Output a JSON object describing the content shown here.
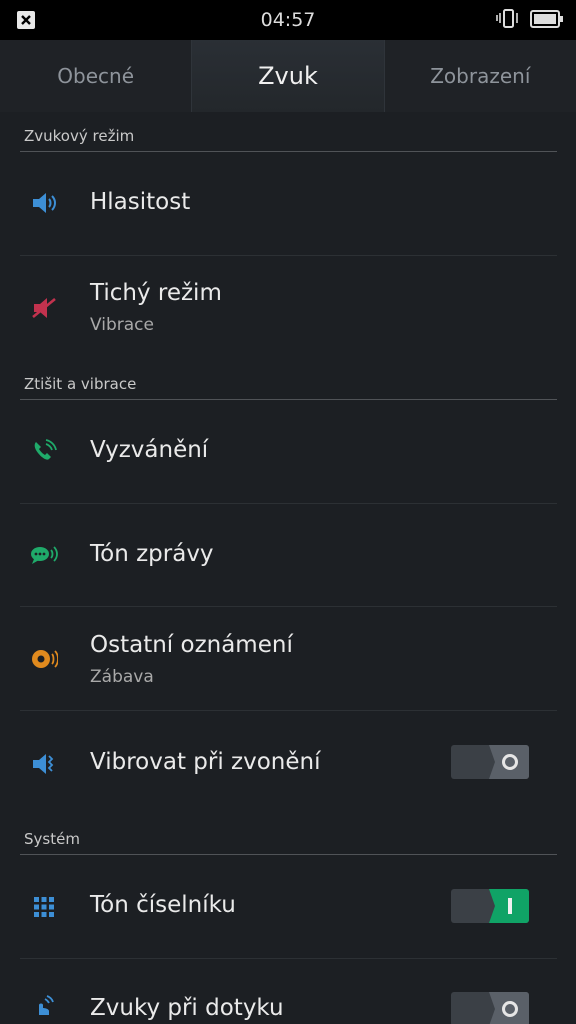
{
  "status": {
    "time": "04:57",
    "notification_icon": "close-box-icon",
    "vibrate_icon": "vibrate-icon",
    "battery_icon": "battery-icon"
  },
  "tabs": [
    {
      "label": "Obecné",
      "active": false
    },
    {
      "label": "Zvuk",
      "active": true
    },
    {
      "label": "Zobrazení",
      "active": false
    }
  ],
  "sections": {
    "sound_mode": "Zvukový režim",
    "mute_vibrate": "Ztišit a vibrace",
    "system": "Systém"
  },
  "items": {
    "volume": {
      "title": "Hlasitost",
      "icon": "speaker-icon",
      "color": "#3d8fd6"
    },
    "silent": {
      "title": "Tichý režim",
      "subtitle": "Vibrace",
      "icon": "mute-icon",
      "color": "#c2324e"
    },
    "ringtone": {
      "title": "Vyzvánění",
      "icon": "phone-ring-icon",
      "color": "#1faa6a"
    },
    "message_tone": {
      "title": "Tón zprávy",
      "icon": "message-sound-icon",
      "color": "#1faa6a"
    },
    "other_notifications": {
      "title": "Ostatní oznámení",
      "subtitle": "Zábava",
      "icon": "notification-sound-icon",
      "color": "#e08a1e"
    },
    "vibrate_on_ring": {
      "title": "Vibrovat při zvonění",
      "icon": "speaker-vibrate-icon",
      "color": "#3d8fd6",
      "toggle": false
    },
    "dialpad_tone": {
      "title": "Tón číselníku",
      "icon": "dialpad-icon",
      "color": "#3d8fd6",
      "toggle": true
    },
    "touch_sounds": {
      "title": "Zvuky při dotyku",
      "icon": "touch-sound-icon",
      "color": "#3d8fd6",
      "toggle": false
    }
  }
}
